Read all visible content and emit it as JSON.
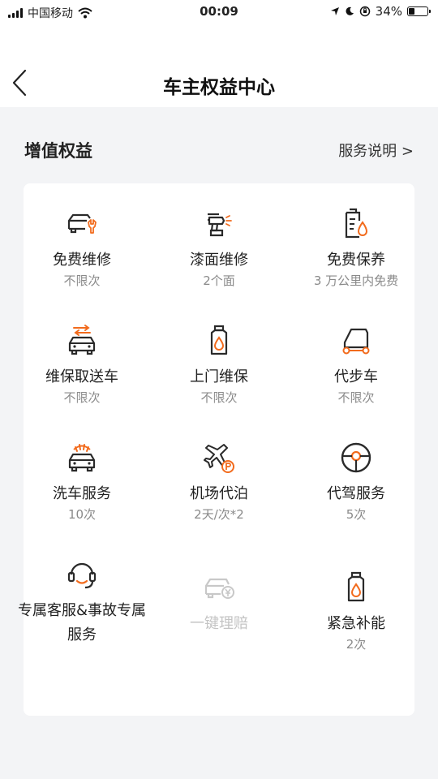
{
  "status_bar": {
    "carrier": "中国移动",
    "time": "00:09",
    "battery": "34%",
    "battery_level": 0.34
  },
  "header": {
    "title": "车主权益中心",
    "back_icon": "chevron-left-icon"
  },
  "section": {
    "title": "增值权益",
    "link_label": "服务说明 >"
  },
  "colors": {
    "accent": "#f26b1d",
    "icon_dark": "#2a2a2a",
    "disabled": "#c8c8c8"
  },
  "benefits": [
    {
      "label": "免费维修",
      "sub": "不限次",
      "icon": "car-repair-icon"
    },
    {
      "label": "漆面维修",
      "sub": "2个面",
      "icon": "spray-gun-icon"
    },
    {
      "label": "免费保养",
      "sub": "3 万公里内免费",
      "icon": "oil-maintenance-icon"
    },
    {
      "label": "维保取送车",
      "sub": "不限次",
      "icon": "car-pickup-icon"
    },
    {
      "label": "上门维保",
      "sub": "不限次",
      "icon": "oil-bottle-icon"
    },
    {
      "label": "代步车",
      "sub": "不限次",
      "icon": "courtesy-car-icon"
    },
    {
      "label": "洗车服务",
      "sub": "10次",
      "icon": "car-wash-icon"
    },
    {
      "label": "机场代泊",
      "sub": "2天/次*2",
      "icon": "airport-parking-icon"
    },
    {
      "label": "代驾服务",
      "sub": "5次",
      "icon": "steering-wheel-icon"
    },
    {
      "label": "专属客服&事故专属服务",
      "sub": "",
      "icon": "headset-icon"
    },
    {
      "label": "一键理赔",
      "sub": "",
      "icon": "car-claim-icon"
    },
    {
      "label": "紧急补能",
      "sub": "2次",
      "icon": "fuel-can-icon"
    }
  ]
}
